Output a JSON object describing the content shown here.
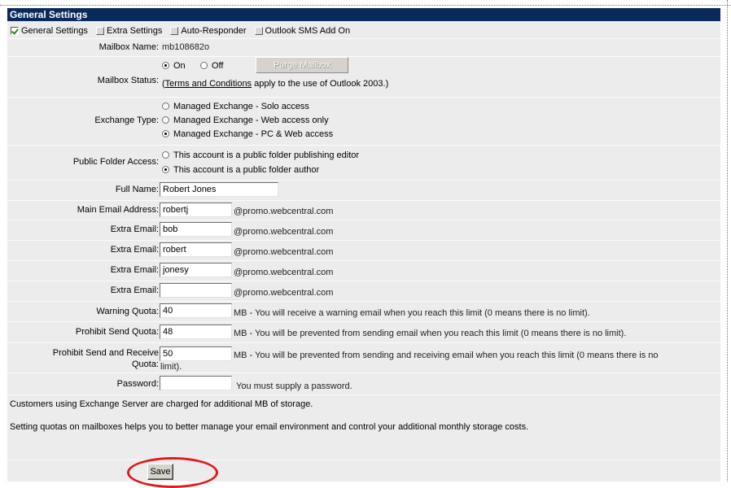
{
  "header": {
    "title": "General Settings"
  },
  "tabs": [
    {
      "label": "General Settings",
      "checked": true
    },
    {
      "label": "Extra Settings",
      "checked": false
    },
    {
      "label": "Auto-Responder",
      "checked": false
    },
    {
      "label": "Outlook SMS Add On",
      "checked": false
    }
  ],
  "mailbox_name": {
    "label": "Mailbox Name:",
    "value": "mb108682o"
  },
  "mailbox_status": {
    "label": "Mailbox Status:",
    "on_label": "On",
    "off_label": "Off",
    "selected": "On",
    "purge_label": "Purge Mailbox",
    "terms_link": "Terms and Conditions",
    "terms_rest": " apply to the use of Outlook 2003.)",
    "terms_open": "("
  },
  "exchange_type": {
    "label": "Exchange Type:",
    "options": [
      "Managed Exchange - Solo access",
      "Managed Exchange - Web access only",
      "Managed Exchange - PC & Web access"
    ],
    "selected_index": 2
  },
  "public_folder": {
    "label": "Public Folder Access:",
    "options": [
      "This account is a public folder publishing editor",
      "This account is a public folder author"
    ],
    "selected_index": 1
  },
  "full_name": {
    "label": "Full Name:",
    "value": "Robert Jones"
  },
  "main_email": {
    "label": "Main Email Address:",
    "value": "robertj",
    "domain": "@promo.webcentral.com"
  },
  "extra_emails": [
    {
      "label": "Extra Email:",
      "value": "bob",
      "domain": "@promo.webcentral.com"
    },
    {
      "label": "Extra Email:",
      "value": "robert",
      "domain": "@promo.webcentral.com"
    },
    {
      "label": "Extra Email:",
      "value": "jonesy",
      "domain": "@promo.webcentral.com"
    },
    {
      "label": "Extra Email:",
      "value": "",
      "domain": "@promo.webcentral.com"
    }
  ],
  "warning_quota": {
    "label": "Warning Quota:",
    "value": "40",
    "note": "MB  - You will receive a warning email when you reach this limit (0 means there is no limit)."
  },
  "prohibit_send_quota": {
    "label": "Prohibit Send Quota:",
    "value": "48",
    "note": "MB  - You will be prevented from sending email when you reach this limit (0 means there is no limit)."
  },
  "prohibit_send_receive_quota": {
    "label_line1": "Prohibit Send and Receive",
    "label_line2": "Quota:",
    "value": "50",
    "note_line1": "MB  - You will be prevented from sending and receiving email when you reach this limit (0 means there is no",
    "note_line2": "limit)."
  },
  "password": {
    "label": "Password:",
    "value": "",
    "note": "You must supply a password."
  },
  "info": {
    "line1": "Customers using Exchange Server are charged for additional MB of storage.",
    "line2": "Setting quotas on mailboxes helps you to better manage your email environment and control your additional monthly storage costs."
  },
  "save_label": "Save",
  "annotation_color": "#e01b1b"
}
